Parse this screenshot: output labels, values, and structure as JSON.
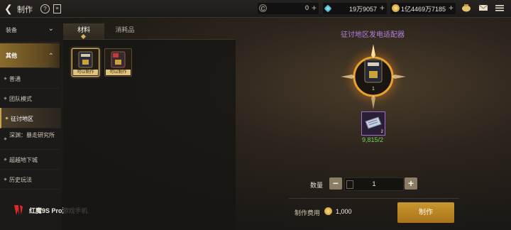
{
  "header": {
    "title": "制作",
    "currencies": [
      {
        "icon": "c-coin-icon",
        "value": "0",
        "color": "#8a826f"
      },
      {
        "icon": "blue-gem-icon",
        "value": "19万9057",
        "color": "#3ab8c8"
      },
      {
        "icon": "gold-coin-icon",
        "value": "1亿4469万7185",
        "color": "#e0b040"
      }
    ]
  },
  "nav": {
    "categories": [
      {
        "label": "装备",
        "expanded": false
      },
      {
        "label": "其他",
        "expanded": true
      }
    ],
    "subs": [
      {
        "label": "普通"
      },
      {
        "label": "团队模式"
      },
      {
        "label": "征讨地区"
      },
      {
        "label": "深渊：暴走研究所"
      },
      {
        "label": "超越地下城"
      },
      {
        "label": "历史玩法"
      }
    ]
  },
  "tabs": [
    {
      "label": "材料"
    },
    {
      "label": "消耗品"
    }
  ],
  "items": [
    {
      "caption": "可以制作",
      "selected": true
    },
    {
      "caption": "可以制作",
      "selected": false
    }
  ],
  "product": {
    "name": "征讨地区发电适配器",
    "count": "1",
    "material_count": "2",
    "material_need": "9,815/2"
  },
  "craft": {
    "qty_label": "数量",
    "quantity": "1",
    "cost_label": "制作费用",
    "cost": "1,000",
    "make_label": "制作"
  },
  "brand": "红魔9S Pro游戏手机"
}
